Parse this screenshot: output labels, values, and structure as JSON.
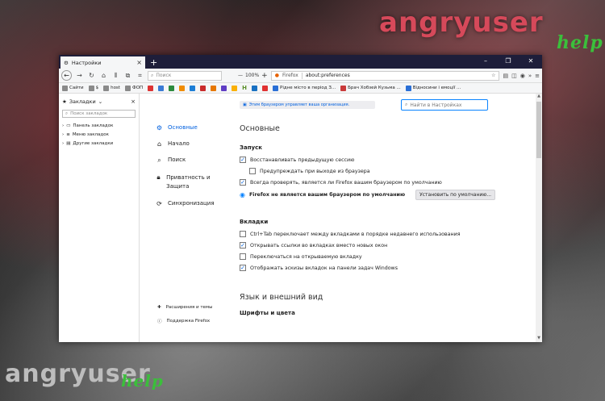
{
  "background": {
    "watermarks": {
      "top": "angryuser",
      "top_help": "help",
      "bottom": "angryuser",
      "bottom_help": "help"
    }
  },
  "window": {
    "tab_title": "Настройки",
    "new_tab": "+",
    "controls": {
      "minimize": "–",
      "maximize": "❐",
      "close": "✕"
    }
  },
  "navbar": {
    "search_placeholder": "Поиск",
    "zoom_minus": "—",
    "zoom_level": "100%",
    "zoom_plus": "+",
    "identity_label": "Firefox",
    "url": "about:preferences"
  },
  "bookmarks_toolbar": [
    {
      "label": "Сайти",
      "color": "#888888"
    },
    {
      "label": "$",
      "color": "#888888"
    },
    {
      "label": "host",
      "color": "#888888"
    },
    {
      "label": "ФОП",
      "color": "#888888"
    },
    {
      "label": "H",
      "color": "#5a8f2a"
    },
    {
      "label": "Рідне місто в період З...",
      "color": "#2a6fd6"
    },
    {
      "label": "Брач Хобзей Кузьма ...",
      "color": "#c93a3a"
    },
    {
      "label": "Відносини і емоції ...",
      "color": "#2a6fd6"
    }
  ],
  "sidebar": {
    "title": "Закладки",
    "search_placeholder": "Поиск закладок",
    "items": [
      {
        "label": "Панель закладок"
      },
      {
        "label": "Меню закладок"
      },
      {
        "label": "Другие закладки"
      }
    ]
  },
  "prefs_nav": {
    "items": [
      {
        "label": "Основные",
        "icon": "gear-icon",
        "active": true
      },
      {
        "label": "Начало",
        "icon": "home-icon",
        "active": false
      },
      {
        "label": "Поиск",
        "icon": "search-icon",
        "active": false
      },
      {
        "label": "Приватность и Защита",
        "icon": "lock-icon",
        "active": false
      },
      {
        "label": "Синхронизация",
        "icon": "sync-icon",
        "active": false
      }
    ],
    "bottom": [
      {
        "label": "Расширения и темы"
      },
      {
        "label": "Поддержка Firefox"
      }
    ]
  },
  "banner": {
    "text": "Этим браузером управляет ваша организация."
  },
  "find": {
    "placeholder": "Найти в Настройках"
  },
  "pane": {
    "title": "Основные",
    "startup": {
      "heading": "Запуск",
      "restore_session": "Восстанавливать предыдущую сессию",
      "warn_on_quit": "Предупреждать при выходе из браузера",
      "check_default": "Всегда проверять, является ли Firefox вашим браузером по умолчанию",
      "not_default": "Firefox не является вашим браузером по умолчанию",
      "make_default": "Установить по умолчанию..."
    },
    "tabs": {
      "heading": "Вкладки",
      "ctrl_tab": "Ctrl+Tab переключает между вкладками в порядке недавнего использования",
      "open_links": "Открывать ссылки во вкладках вместо новых окон",
      "switch_to_new": "Переключаться на открываемую вкладку",
      "show_previews": "Отображать эскизы вкладок на панели задач Windows"
    },
    "language_title": "Язык и внешний вид",
    "fonts_heading": "Шрифты и цвета"
  }
}
